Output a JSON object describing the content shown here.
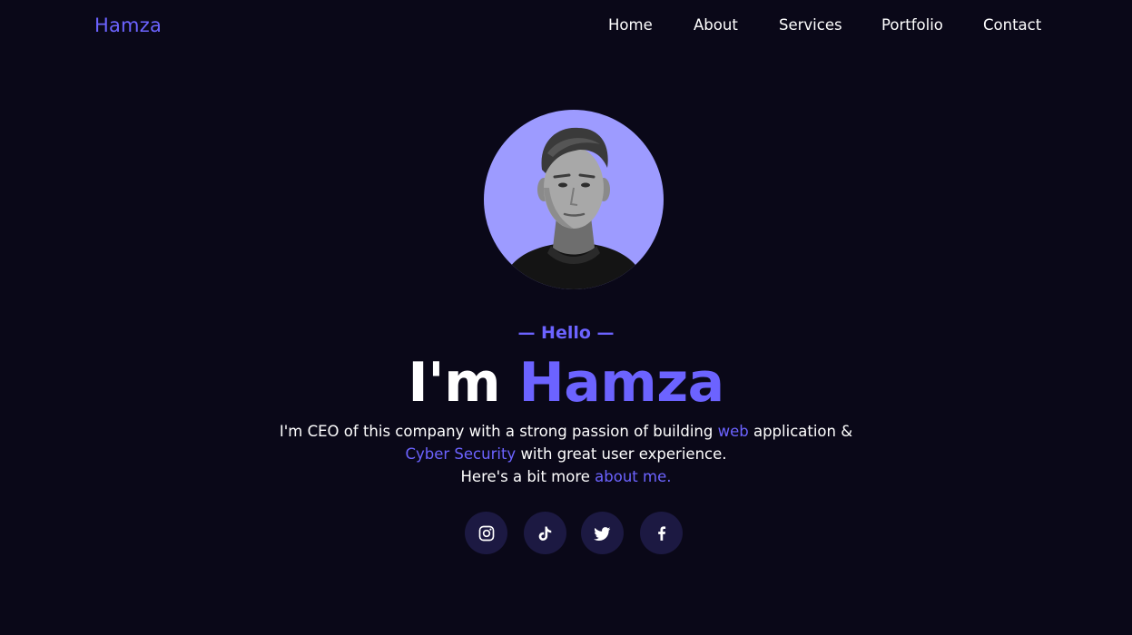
{
  "header": {
    "logo": "Hamza",
    "nav": [
      "Home",
      "About",
      "Services",
      "Portfolio",
      "Contact"
    ]
  },
  "hero": {
    "hello": "— Hello —",
    "headline_prefix": "I'm",
    "headline_name": "Hamza",
    "line1_a": "I'm CEO of this company with a strong passion of building",
    "line1_hl": "web",
    "line1_b": "application &",
    "line2_hl": "Cyber Security",
    "line2_b": "with great user experience.",
    "line3_a": "Here's a bit more",
    "line3_link": "about me."
  },
  "social": [
    {
      "icon": "instagram-icon"
    },
    {
      "icon": "tiktok-icon"
    },
    {
      "icon": "twitter-icon"
    },
    {
      "icon": "facebook-icon"
    }
  ],
  "colors": {
    "background": "#0a0818",
    "accent": "#6c63ff",
    "avatar_bg": "#9d9bff",
    "social_bg": "#1c1942"
  }
}
